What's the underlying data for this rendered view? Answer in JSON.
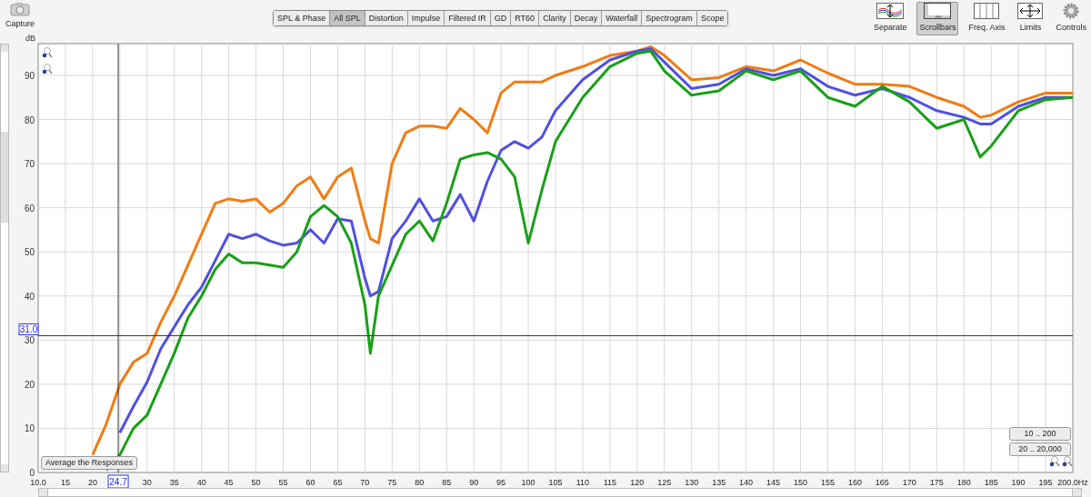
{
  "capture": {
    "label": "Capture"
  },
  "tabs": [
    {
      "label": "SPL & Phase",
      "selected": false
    },
    {
      "label": "All SPL",
      "selected": true
    },
    {
      "label": "Distortion",
      "selected": false
    },
    {
      "label": "Impulse",
      "selected": false
    },
    {
      "label": "Filtered IR",
      "selected": false
    },
    {
      "label": "GD",
      "selected": false
    },
    {
      "label": "RT60",
      "selected": false
    },
    {
      "label": "Clarity",
      "selected": false
    },
    {
      "label": "Decay",
      "selected": false
    },
    {
      "label": "Waterfall",
      "selected": false
    },
    {
      "label": "Spectrogram",
      "selected": false
    },
    {
      "label": "Scope",
      "selected": false
    }
  ],
  "tools": [
    {
      "label": "Separate",
      "kind": "separate",
      "selected": false
    },
    {
      "label": "Scrollbars",
      "kind": "scrollbars",
      "selected": true
    },
    {
      "label": "Freq. Axis",
      "kind": "freqaxis",
      "selected": false
    },
    {
      "label": "Limits",
      "kind": "limits",
      "selected": false
    },
    {
      "label": "Controls",
      "kind": "controls",
      "selected": false
    }
  ],
  "graph": {
    "chart_data": {
      "type": "line",
      "ylabel": "dB",
      "xlim": [
        10,
        200
      ],
      "ylim": [
        0,
        97.2
      ],
      "xticks": [
        {
          "value": 10,
          "label": "10.0"
        },
        15,
        20,
        30,
        35,
        40,
        45,
        50,
        55,
        60,
        65,
        70,
        75,
        80,
        85,
        90,
        95,
        100,
        105,
        110,
        115,
        120,
        125,
        130,
        135,
        140,
        145,
        150,
        155,
        160,
        165,
        170,
        175,
        180,
        185,
        190,
        195,
        {
          "value": 200,
          "label": "200.0Hz"
        }
      ],
      "yticks": [
        0,
        10,
        20,
        30,
        40,
        50,
        60,
        70,
        80,
        90
      ],
      "x": [
        20,
        22.5,
        25,
        27.5,
        30,
        32.5,
        35,
        37.5,
        40,
        42.5,
        45,
        47.5,
        50,
        52.5,
        55,
        57.5,
        60,
        62.5,
        65,
        67.5,
        70,
        71,
        72.5,
        75,
        77.5,
        80,
        82.5,
        85,
        87.5,
        90,
        92.5,
        95,
        97.5,
        100,
        102.5,
        105,
        110,
        115,
        120,
        122.5,
        125,
        130,
        135,
        140,
        145,
        150,
        155,
        160,
        165,
        170,
        175,
        180,
        183,
        185,
        190,
        195,
        200
      ],
      "series": [
        {
          "color": "#f07c12",
          "values": [
            4,
            11,
            20,
            25,
            27,
            34,
            40,
            47,
            54,
            61,
            62,
            61.5,
            62,
            59,
            61,
            65,
            67,
            62,
            67,
            69,
            57,
            53,
            52,
            70,
            77,
            78.5,
            78.5,
            78,
            82.5,
            80,
            77,
            86,
            88.5,
            88.5,
            88.5,
            90,
            92,
            94.5,
            95.5,
            96.5,
            94.5,
            89,
            89.5,
            92,
            91,
            93.5,
            90.5,
            88,
            88,
            87.5,
            85,
            83,
            80.5,
            81,
            84,
            86,
            86
          ]
        },
        {
          "color": "#5050e0",
          "values": [
            null,
            null,
            9,
            15,
            20.5,
            28,
            33,
            38,
            42,
            48,
            54,
            53,
            54,
            52.5,
            51.5,
            52,
            55,
            52,
            57.5,
            57,
            44,
            40,
            41,
            53,
            57,
            62,
            57,
            58,
            63,
            57,
            66,
            73,
            75,
            73.5,
            76,
            82,
            89,
            93.5,
            95.5,
            96,
            93,
            87,
            88,
            91.5,
            90,
            91.5,
            87.5,
            85.5,
            87,
            85,
            82,
            80.5,
            79,
            79,
            83,
            85,
            85
          ]
        },
        {
          "color": "#18a018",
          "values": [
            null,
            0.5,
            4,
            10,
            13,
            20,
            27,
            35,
            40,
            46,
            49.5,
            47.5,
            47.5,
            47,
            46.5,
            50,
            58,
            60.5,
            58,
            52,
            38,
            27,
            40,
            47,
            54,
            57,
            52.5,
            61,
            71,
            72,
            72.5,
            71,
            67,
            52,
            64,
            75,
            85,
            92,
            95,
            95.5,
            91,
            85.5,
            86.5,
            91,
            89,
            91,
            85,
            83,
            87.5,
            84,
            78,
            80,
            71.5,
            74,
            82,
            84.5,
            85
          ]
        }
      ],
      "grid": true,
      "ref_lines": [
        {
          "axis": "x",
          "value": 24.7,
          "label": "24.7"
        },
        {
          "axis": "y",
          "value": 31,
          "label": "31.0"
        }
      ]
    }
  },
  "buttons": {
    "average": "Average the Responses",
    "range_low": "10 .. 200",
    "range_full": "20 .. 20,000"
  }
}
